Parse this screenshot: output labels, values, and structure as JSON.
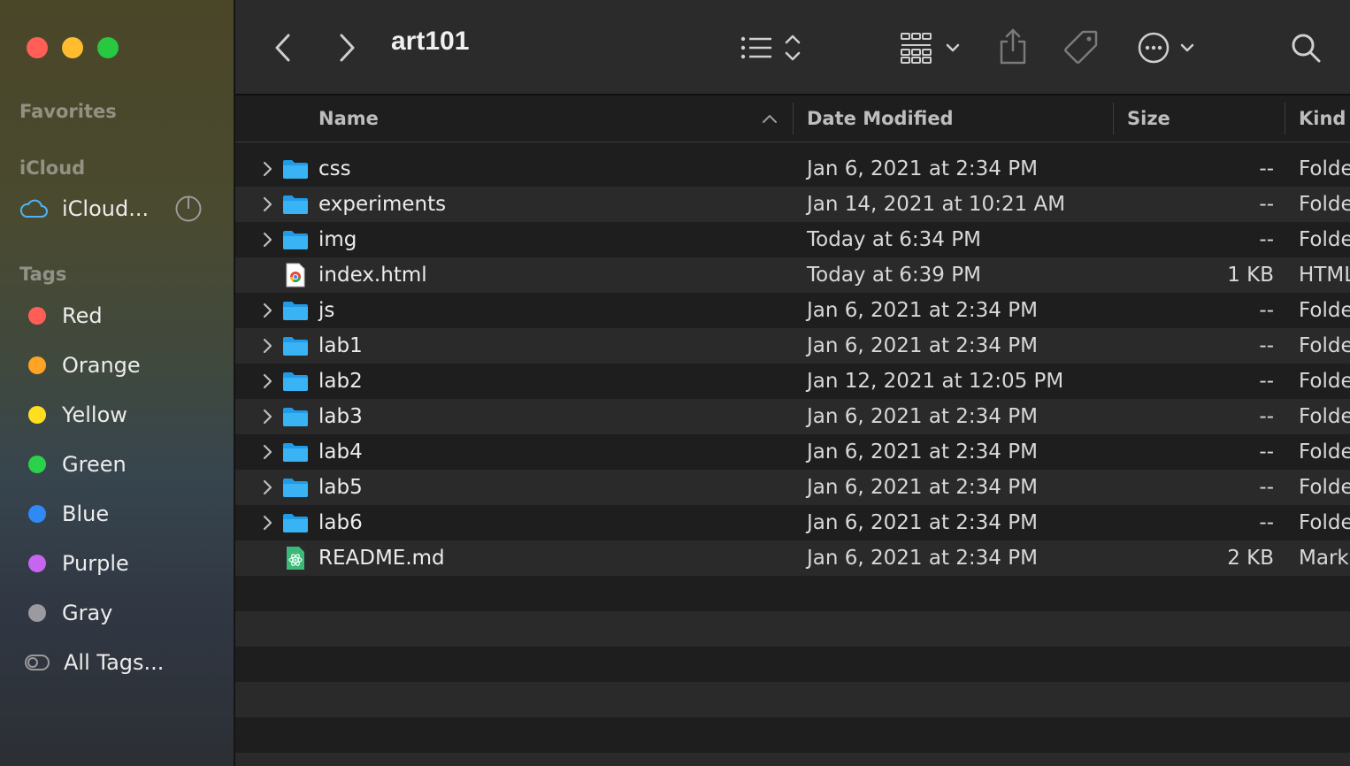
{
  "window": {
    "title": "art101"
  },
  "sidebar": {
    "favorites_heading": "Favorites",
    "icloud_heading": "iCloud",
    "icloud_item": "iCloud...",
    "tags_heading": "Tags",
    "tags": [
      {
        "label": "Red",
        "color": "#ff5e57"
      },
      {
        "label": "Orange",
        "color": "#ffa424"
      },
      {
        "label": "Yellow",
        "color": "#ffde1f"
      },
      {
        "label": "Green",
        "color": "#2ad14a"
      },
      {
        "label": "Blue",
        "color": "#2f8af6"
      },
      {
        "label": "Purple",
        "color": "#c764f0"
      },
      {
        "label": "Gray",
        "color": "#9a9aa0"
      }
    ],
    "all_tags": "All Tags..."
  },
  "toolbar": {
    "back_icon": "chevron-left-icon",
    "forward_icon": "chevron-right-icon",
    "view_icon": "list-view-icon",
    "group_icon": "grid-group-icon",
    "share_icon": "share-icon",
    "tag_icon": "tag-icon",
    "action_icon": "ellipsis-circle-icon",
    "search_icon": "search-icon"
  },
  "columns": {
    "name": "Name",
    "date": "Date Modified",
    "size": "Size",
    "kind": "Kind"
  },
  "files": [
    {
      "name": "css",
      "date": "Jan 6, 2021 at 2:34 PM",
      "size": "--",
      "kind": "Folder",
      "type": "folder"
    },
    {
      "name": "experiments",
      "date": "Jan 14, 2021 at 10:21 AM",
      "size": "--",
      "kind": "Folder",
      "type": "folder"
    },
    {
      "name": "img",
      "date": "Today at 6:34 PM",
      "size": "--",
      "kind": "Folder",
      "type": "folder"
    },
    {
      "name": "index.html",
      "date": "Today at 6:39 PM",
      "size": "1 KB",
      "kind": "HTML",
      "type": "html"
    },
    {
      "name": "js",
      "date": "Jan 6, 2021 at 2:34 PM",
      "size": "--",
      "kind": "Folder",
      "type": "folder"
    },
    {
      "name": "lab1",
      "date": "Jan 6, 2021 at 2:34 PM",
      "size": "--",
      "kind": "Folder",
      "type": "folder"
    },
    {
      "name": "lab2",
      "date": "Jan 12, 2021 at 12:05 PM",
      "size": "--",
      "kind": "Folder",
      "type": "folder"
    },
    {
      "name": "lab3",
      "date": "Jan 6, 2021 at 2:34 PM",
      "size": "--",
      "kind": "Folder",
      "type": "folder"
    },
    {
      "name": "lab4",
      "date": "Jan 6, 2021 at 2:34 PM",
      "size": "--",
      "kind": "Folder",
      "type": "folder"
    },
    {
      "name": "lab5",
      "date": "Jan 6, 2021 at 2:34 PM",
      "size": "--",
      "kind": "Folder",
      "type": "folder"
    },
    {
      "name": "lab6",
      "date": "Jan 6, 2021 at 2:34 PM",
      "size": "--",
      "kind": "Folder",
      "type": "folder"
    },
    {
      "name": "README.md",
      "date": "Jan 6, 2021 at 2:34 PM",
      "size": "2 KB",
      "kind": "Markdown",
      "type": "markdown"
    }
  ]
}
